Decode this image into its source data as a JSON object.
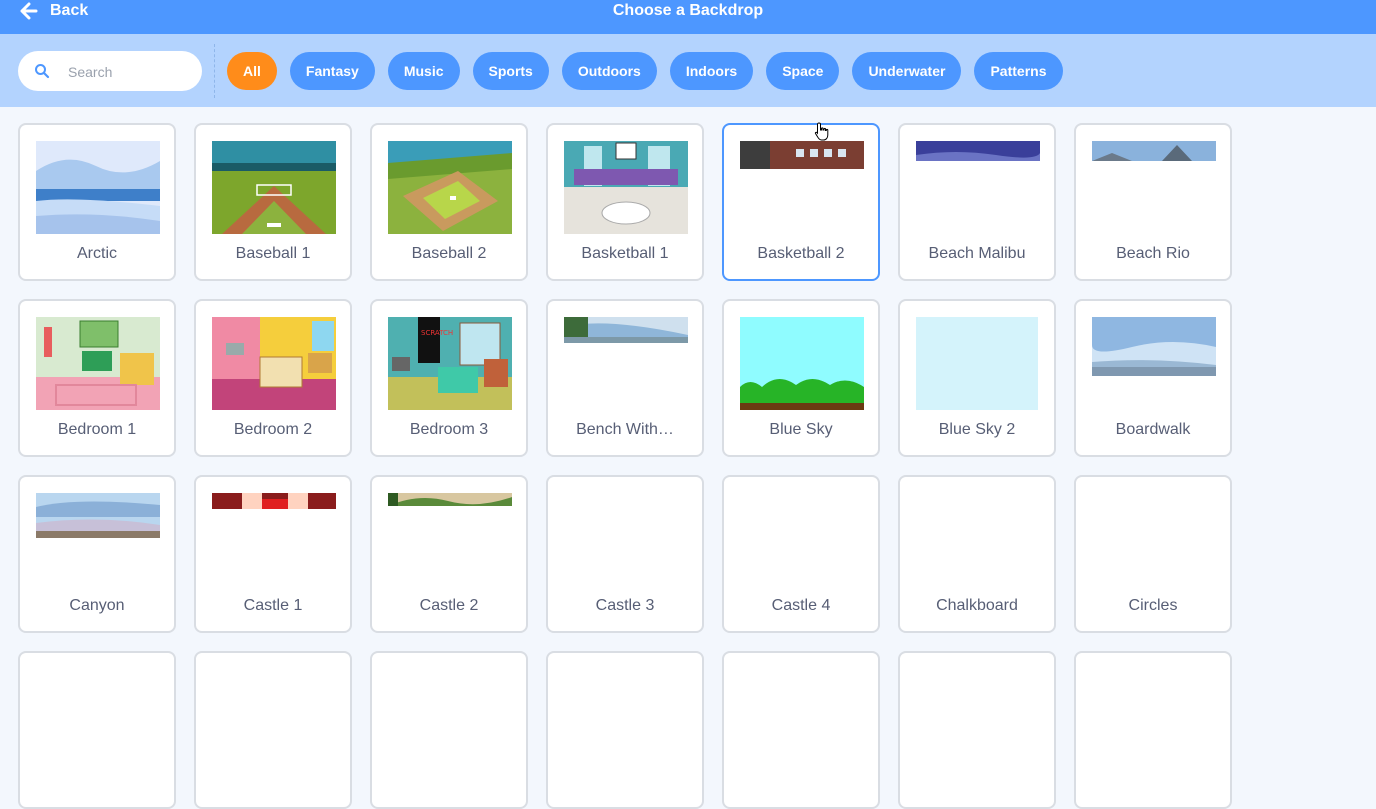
{
  "header": {
    "back_label": "Back",
    "title": "Choose a Backdrop"
  },
  "search": {
    "placeholder": "Search"
  },
  "tags": [
    {
      "label": "All",
      "active": true
    },
    {
      "label": "Fantasy"
    },
    {
      "label": "Music"
    },
    {
      "label": "Sports"
    },
    {
      "label": "Outdoors"
    },
    {
      "label": "Indoors"
    },
    {
      "label": "Space"
    },
    {
      "label": "Underwater"
    },
    {
      "label": "Patterns"
    }
  ],
  "backdrops": [
    {
      "name": "Arctic"
    },
    {
      "name": "Baseball 1"
    },
    {
      "name": "Baseball 2"
    },
    {
      "name": "Basketball 1"
    },
    {
      "name": "Basketball 2",
      "selected": true
    },
    {
      "name": "Beach Malibu"
    },
    {
      "name": "Beach Rio"
    },
    {
      "name": "Bedroom 1"
    },
    {
      "name": "Bedroom 2"
    },
    {
      "name": "Bedroom 3"
    },
    {
      "name": "Bench With…"
    },
    {
      "name": "Blue Sky"
    },
    {
      "name": "Blue Sky 2"
    },
    {
      "name": "Boardwalk"
    },
    {
      "name": "Canyon"
    },
    {
      "name": "Castle 1"
    },
    {
      "name": "Castle 2"
    },
    {
      "name": "Castle 3"
    },
    {
      "name": "Castle 4"
    },
    {
      "name": "Chalkboard"
    },
    {
      "name": "Circles"
    }
  ],
  "colors": {
    "header": "#4d97ff",
    "filter_bar": "#b3d3fe",
    "tag": "#4d97ff",
    "tag_active": "#ff8c1a",
    "selected_border": "#4d97ff"
  }
}
